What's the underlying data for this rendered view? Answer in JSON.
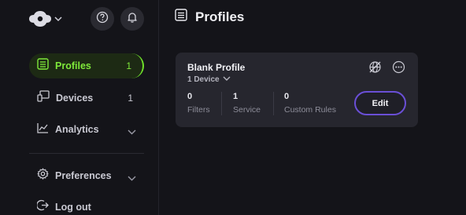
{
  "sidebar": {
    "logo_icon": "rose-logo-icon",
    "items": [
      {
        "label": "Profiles",
        "count": "1",
        "icon": "profiles-icon"
      },
      {
        "label": "Devices",
        "count": "1",
        "icon": "devices-icon"
      },
      {
        "label": "Analytics",
        "icon": "analytics-icon"
      },
      {
        "label": "Preferences",
        "icon": "gear-icon"
      },
      {
        "label": "Log out",
        "icon": "logout-icon"
      }
    ]
  },
  "main": {
    "title": "Profiles"
  },
  "profile_card": {
    "name": "Blank Profile",
    "devices": "1 Device",
    "stats": [
      {
        "value": "0",
        "label": "Filters"
      },
      {
        "value": "1",
        "label": "Service"
      },
      {
        "value": "0",
        "label": "Custom Rules"
      }
    ],
    "edit_label": "Edit"
  },
  "colors": {
    "accent_green": "#6fe12a",
    "accent_purple": "#6a4fd6",
    "background": "#141419",
    "card": "#26262e"
  }
}
